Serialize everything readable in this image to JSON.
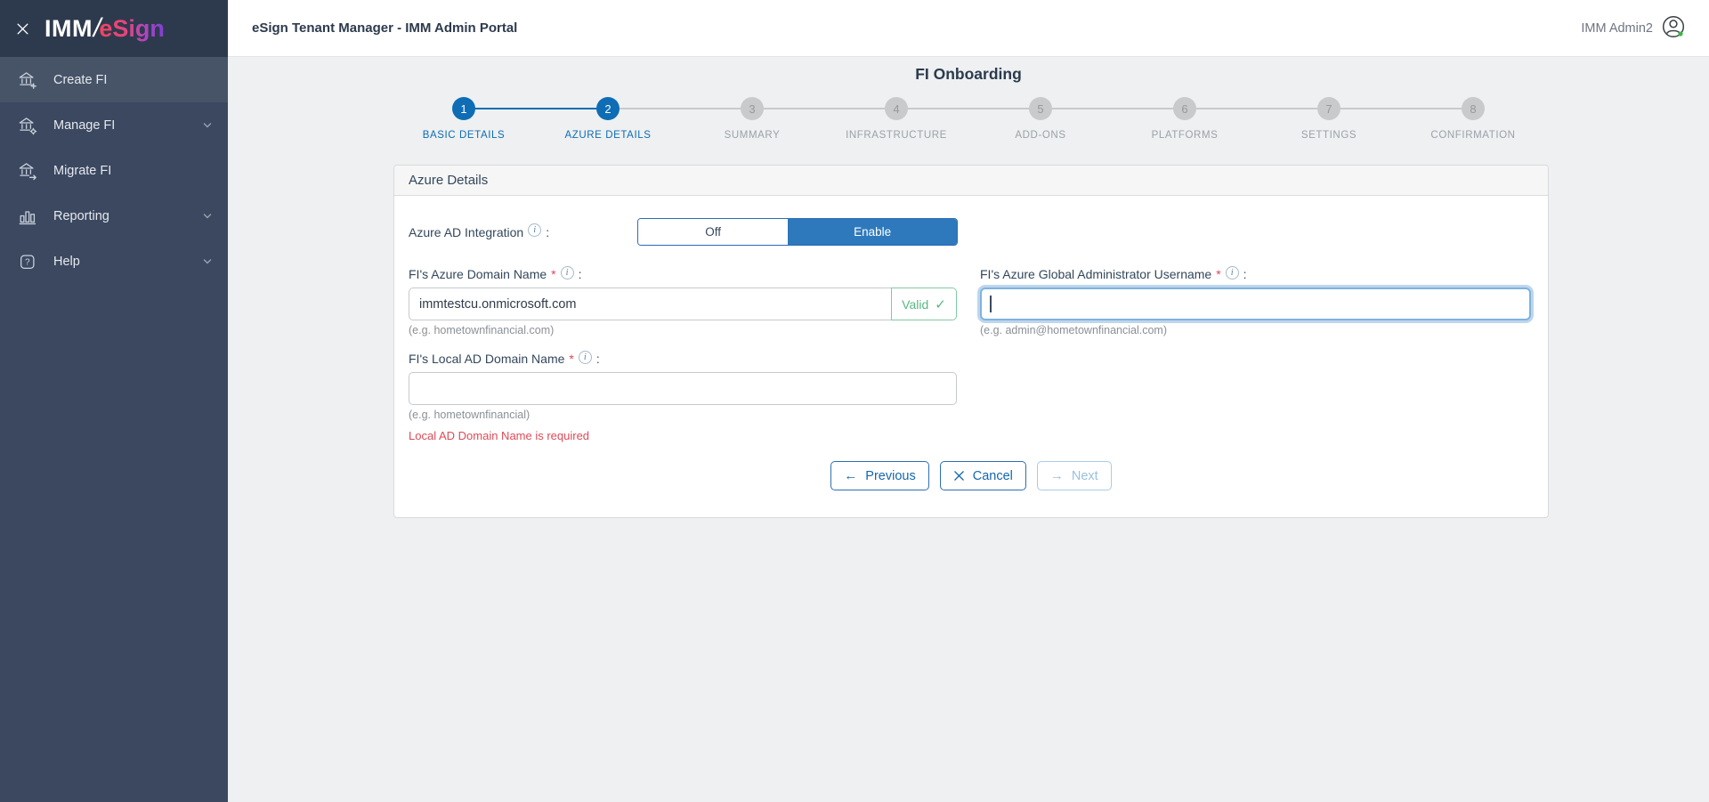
{
  "colors": {
    "primary_blue": "#0e6db4",
    "enable_blue": "#2e79bc",
    "valid_green": "#57b783",
    "error_red": "#df4a57",
    "sidebar_dark": "#2d3a4e",
    "sidebar_body": "#3b4860",
    "logo_gradient_start": "#ef4059",
    "logo_gradient_end": "#7e3fd4",
    "online_green": "#3cb54a"
  },
  "icons": {
    "info": "i",
    "valid_check": "✓",
    "prev_arrow": "←",
    "next_arrow": "→"
  },
  "sidebar": {
    "logo": {
      "imm": "IMM",
      "slash": "/",
      "esign": "eSign"
    },
    "items": [
      {
        "label": "Create FI"
      },
      {
        "label": "Manage FI"
      },
      {
        "label": "Migrate FI"
      },
      {
        "label": "Reporting"
      },
      {
        "label": "Help"
      }
    ]
  },
  "header": {
    "title": "eSign Tenant Manager - IMM Admin Portal",
    "user": "IMM Admin2"
  },
  "page": {
    "title": "FI Onboarding"
  },
  "stepper": {
    "steps": [
      {
        "number": "1",
        "label": "BASIC DETAILS",
        "state": "completed"
      },
      {
        "number": "2",
        "label": "AZURE DETAILS",
        "state": "active"
      },
      {
        "number": "3",
        "label": "SUMMARY",
        "state": "upcoming"
      },
      {
        "number": "4",
        "label": "INFRASTRUCTURE",
        "state": "upcoming"
      },
      {
        "number": "5",
        "label": "ADD-ONS",
        "state": "upcoming"
      },
      {
        "number": "6",
        "label": "PLATFORMS",
        "state": "upcoming"
      },
      {
        "number": "7",
        "label": "SETTINGS",
        "state": "upcoming"
      },
      {
        "number": "8",
        "label": "CONFIRMATION",
        "state": "upcoming"
      }
    ]
  },
  "panel": {
    "title": "Azure Details",
    "punctuation": {
      "colon": ":"
    },
    "azure_ad_integration": {
      "label": "Azure AD Integration",
      "options": [
        "Off",
        "Enable"
      ],
      "selected": "Enable"
    },
    "fields": {
      "azure_domain": {
        "label": "FI's Azure Domain Name",
        "required": "*",
        "value": "immtestcu.onmicrosoft.com",
        "status": "Valid",
        "hint": "(e.g. hometownfinancial.com)"
      },
      "admin_username": {
        "label": "FI's Azure Global Administrator Username",
        "required": "*",
        "value": "",
        "hint": "(e.g. admin@hometownfinancial.com)"
      },
      "local_ad_domain": {
        "label": "FI's Local AD Domain Name",
        "required": "*",
        "value": "",
        "hint": "(e.g. hometownfinancial)",
        "error": "Local AD Domain Name is required"
      }
    },
    "buttons": {
      "previous": "Previous",
      "cancel": "Cancel",
      "next": "Next"
    }
  }
}
